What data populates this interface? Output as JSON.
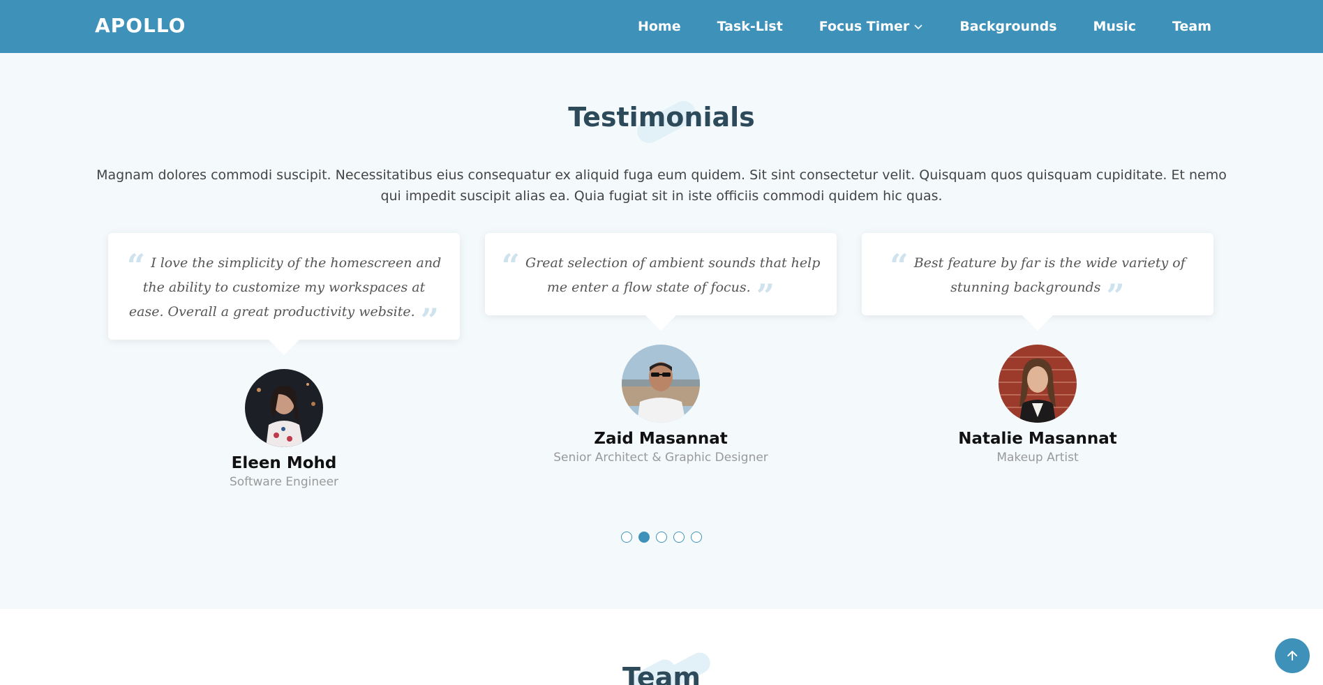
{
  "header": {
    "logo": "APOLLO",
    "nav": [
      {
        "label": "Home"
      },
      {
        "label": "Task-List"
      },
      {
        "label": "Focus Timer",
        "has_dropdown": true
      },
      {
        "label": "Backgrounds"
      },
      {
        "label": "Music"
      },
      {
        "label": "Team"
      }
    ]
  },
  "testimonials": {
    "title": "Testimonials",
    "intro": "Magnam dolores commodi suscipit. Necessitatibus eius consequatur ex aliquid fuga eum quidem. Sit sint consectetur velit. Quisquam quos quisquam cupiditate. Et nemo qui impedit suscipit alias ea. Quia fugiat sit in iste officiis commodi quidem hic quas.",
    "items": [
      {
        "quote": "I love the simplicity of the homescreen and the ability to customize my workspaces at ease. Overall a great productivity website.",
        "name": "Eleen Mohd",
        "role": "Software Engineer"
      },
      {
        "quote": "Great selection of ambient sounds that help me enter a flow state of focus.",
        "name": "Zaid Masannat",
        "role": "Senior Architect & Graphic Designer"
      },
      {
        "quote": "Best feature by far is the wide variety of stunning backgrounds",
        "name": "Natalie Masannat",
        "role": "Makeup Artist"
      }
    ],
    "pagination": {
      "total": 5,
      "active_index": 1
    }
  },
  "team": {
    "title": "Team"
  },
  "colors": {
    "primary": "#3e92ba",
    "heading": "#2d4a5a",
    "background": "#f4f9fc"
  },
  "icons": {
    "dropdown": "chevron-down-icon",
    "scroll_top": "arrow-up-icon"
  }
}
